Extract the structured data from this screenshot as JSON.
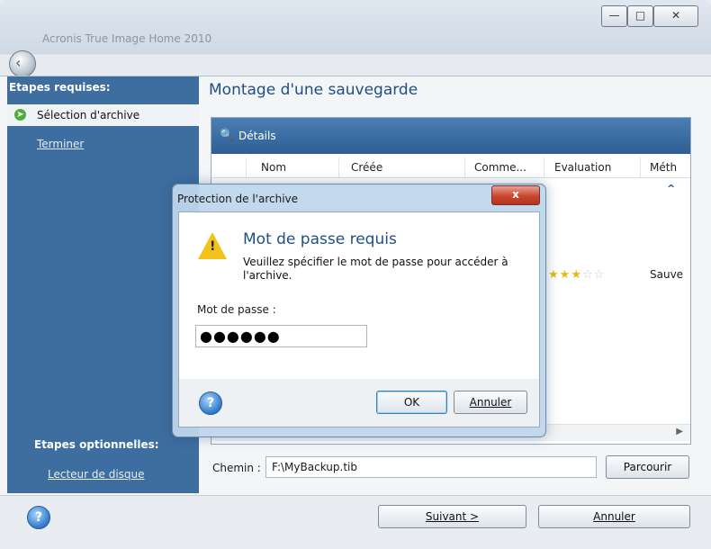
{
  "window": {
    "title": "Acronis True Image Home 2010",
    "controls": {
      "minimize": "—",
      "maximize": "□",
      "close": "✕"
    }
  },
  "sidebar": {
    "required_heading": "Etapes requises:",
    "steps": [
      {
        "label": "Sélection d'archive",
        "selected": true
      },
      {
        "label": "Terminer",
        "selected": false
      }
    ],
    "optional_heading": "Etapes optionnelles:",
    "optional_steps": [
      {
        "label": "Lecteur de disque"
      }
    ]
  },
  "main": {
    "page_title": "Montage d'une sauvegarde",
    "panel_title": "Détails",
    "columns": [
      "Nom",
      "Créée",
      "Comme...",
      "Evaluation",
      "Méth"
    ],
    "row_visible": {
      "rating": 3,
      "rating_max": 5,
      "method_text": "Sauve"
    },
    "path_label": "Chemin :",
    "path_value": "F:\\MyBackup.tib",
    "browse_label": "Parcourir"
  },
  "footer": {
    "next_label": "Suivant >",
    "cancel_label": "Annuler"
  },
  "dialog": {
    "title": "Protection de l'archive",
    "close": "x",
    "heading": "Mot de passe requis",
    "message": "Veuillez spécifier le mot de passe pour accéder à l'archive.",
    "password_label": "Mot de passe :",
    "password_value": "●●●●●●",
    "ok_label": "OK",
    "cancel_label": "Annuler"
  },
  "colors": {
    "sidebar": "#3e6da0",
    "title_blue": "#1f4f86",
    "warning": "#f2c21b",
    "close_red": "#c9462f"
  },
  "icons": [
    "back-icon",
    "details-icon",
    "warning-icon",
    "help-icon",
    "arrow-icon",
    "star-icon"
  ]
}
